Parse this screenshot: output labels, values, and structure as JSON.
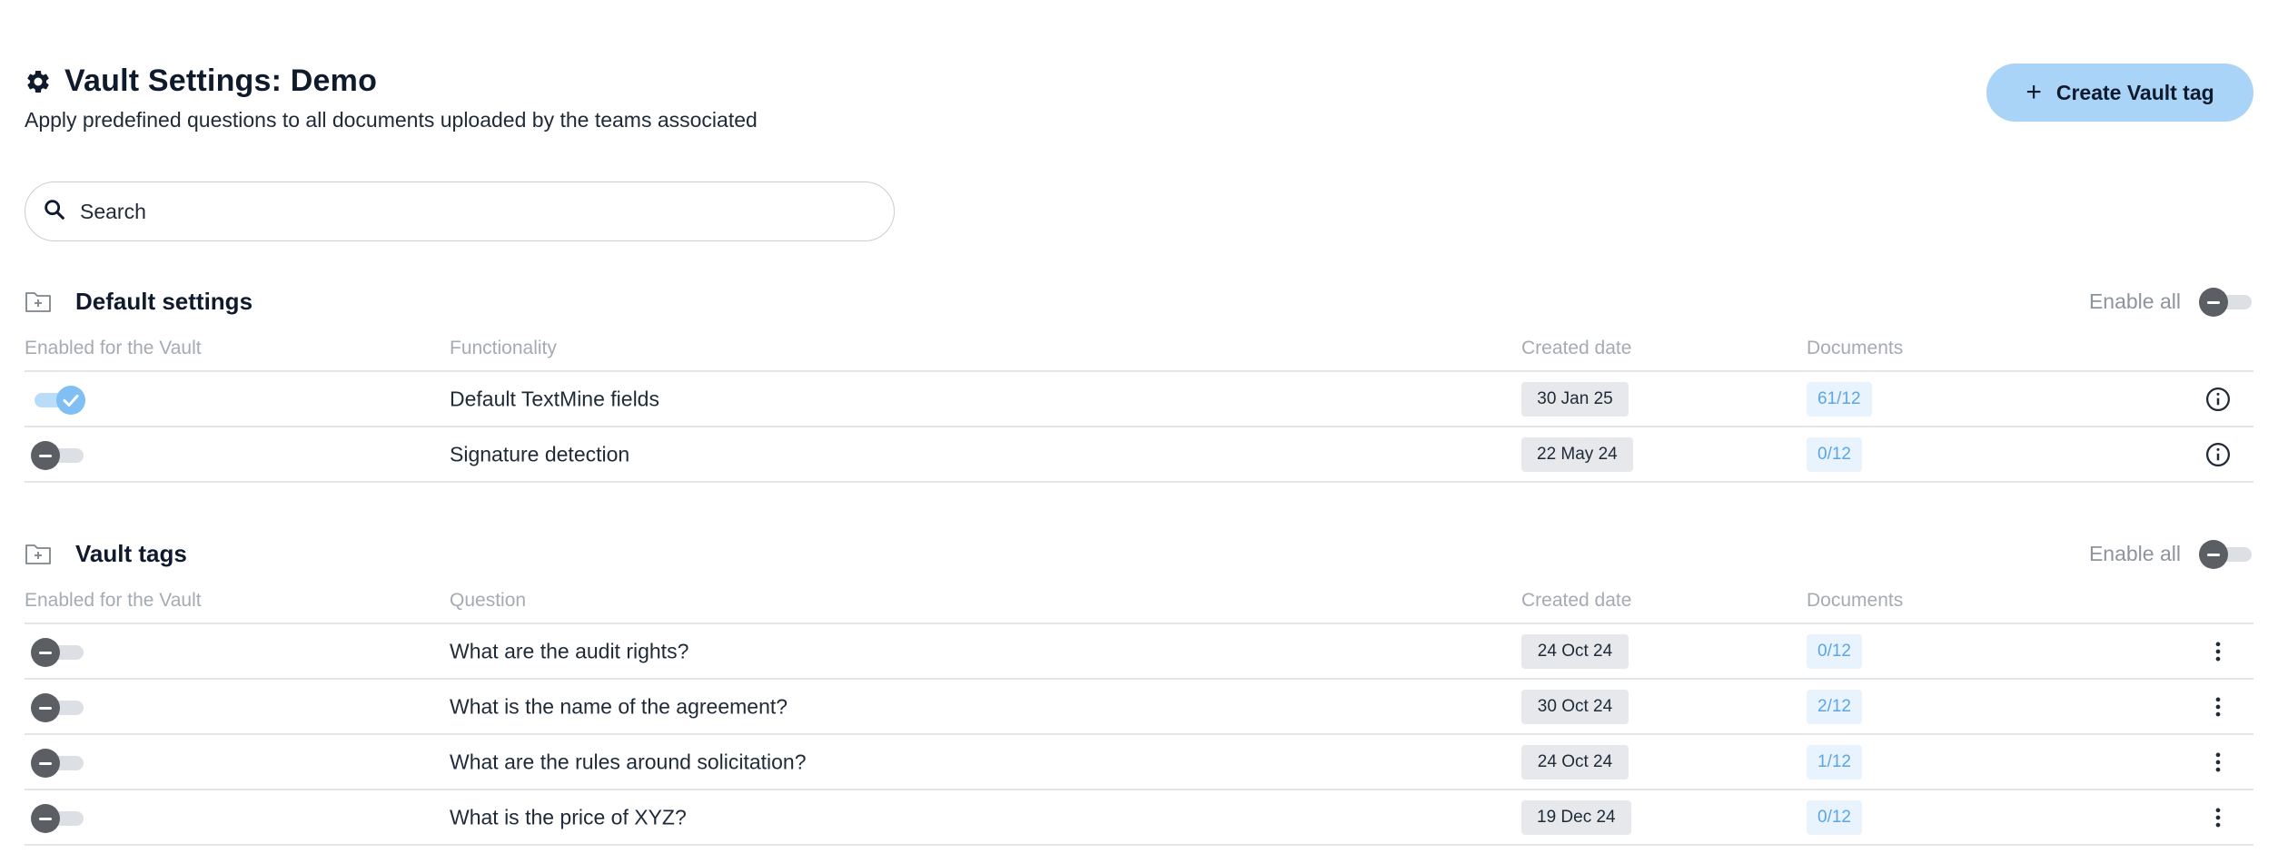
{
  "header": {
    "title": "Vault Settings: Demo",
    "subtitle": "Apply predefined questions to all documents uploaded by the teams associated",
    "create_button_label": "Create Vault tag"
  },
  "search": {
    "placeholder": "Search",
    "value": ""
  },
  "default_settings": {
    "title": "Default settings",
    "enable_all_label": "Enable all",
    "columns": [
      "Enabled for the Vault",
      "Functionality",
      "Created date",
      "Documents"
    ],
    "rows": [
      {
        "enabled": true,
        "text": "Default TextMine fields",
        "date": "30 Jan 25",
        "documents": "61/12",
        "action_icon": "info-icon"
      },
      {
        "enabled": false,
        "text": "Signature detection",
        "date": "22 May 24",
        "documents": "0/12",
        "action_icon": "info-icon"
      }
    ]
  },
  "vault_tags": {
    "title": "Vault tags",
    "enable_all_label": "Enable all",
    "columns": [
      "Enabled for the Vault",
      "Question",
      "Created date",
      "Documents"
    ],
    "rows": [
      {
        "enabled": false,
        "text": "What are the audit rights?",
        "date": "24 Oct 24",
        "documents": "0/12",
        "action_icon": "more-vertical-icon"
      },
      {
        "enabled": false,
        "text": "What is the name of the agreement?",
        "date": "30 Oct 24",
        "documents": "2/12",
        "action_icon": "more-vertical-icon"
      },
      {
        "enabled": false,
        "text": "What are the rules around solicitation?",
        "date": "24 Oct 24",
        "documents": "1/12",
        "action_icon": "more-vertical-icon"
      },
      {
        "enabled": false,
        "text": "What is the price of XYZ?",
        "date": "19 Dec 24",
        "documents": "0/12",
        "action_icon": "more-vertical-icon"
      }
    ]
  },
  "colors": {
    "accent": "#a9d3f7",
    "toggle_on": "#7fbff3",
    "toggle_off_knob": "#5b5f64",
    "documents_text": "#5aa6e6",
    "date_badge_bg": "#e6e8eb"
  }
}
